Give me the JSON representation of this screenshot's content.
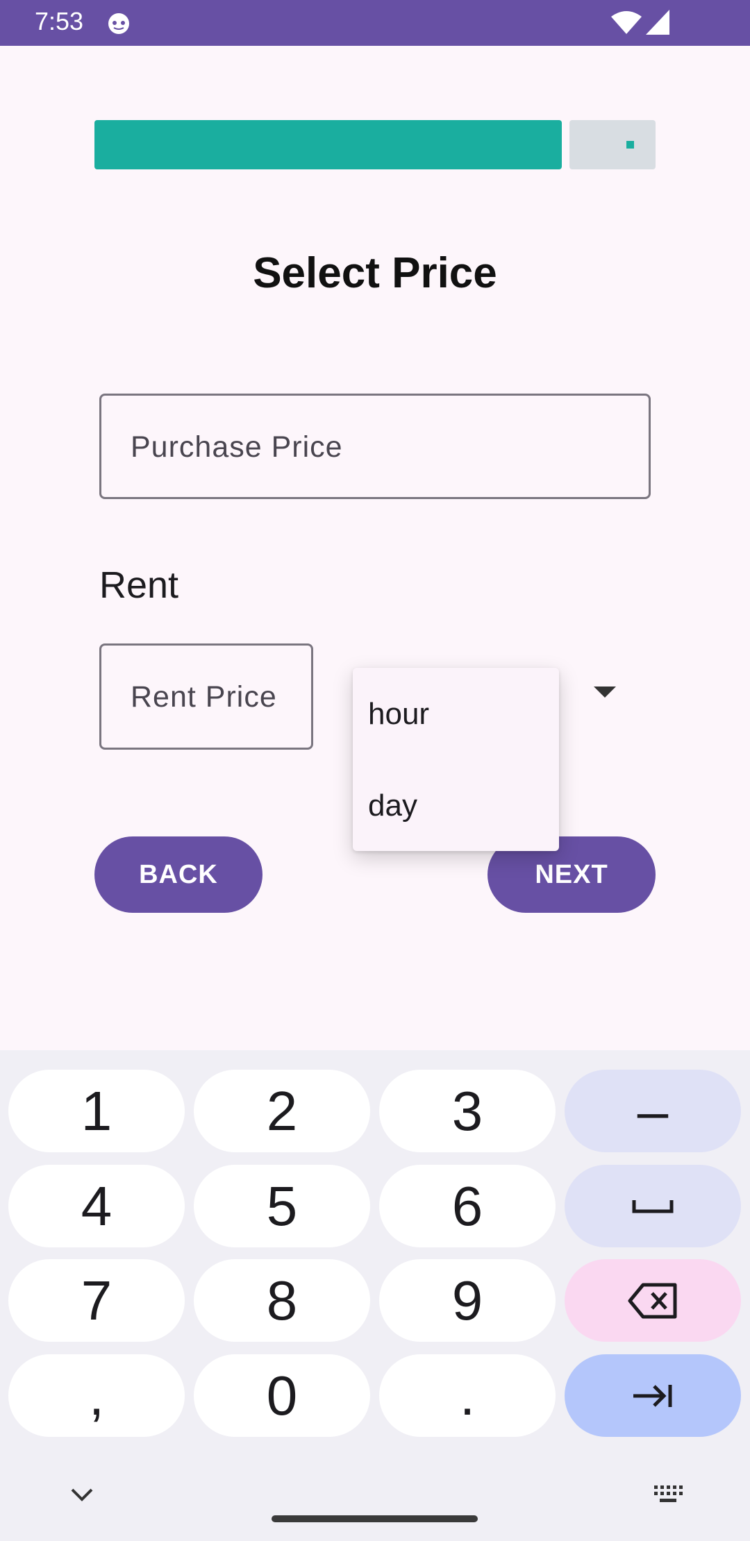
{
  "status_bar": {
    "time": "7:53",
    "background": "#6750a4"
  },
  "progress": {
    "fraction": 0.85,
    "fill_color": "#1aae9f",
    "track_color": "#d8dde2"
  },
  "page": {
    "title": "Select Price"
  },
  "purchase_price": {
    "placeholder": "Purchase Price",
    "value": ""
  },
  "rent": {
    "label": "Rent",
    "price_placeholder": "Rent Price",
    "price_value": ""
  },
  "dropdown": {
    "options": [
      "hour",
      "day"
    ],
    "icon": "caret-down-icon"
  },
  "buttons": {
    "back": "BACK",
    "next": "NEXT",
    "color": "#6750a4"
  },
  "keyboard": {
    "rows": [
      [
        "1",
        "2",
        "3",
        "–"
      ],
      [
        "4",
        "5",
        "6",
        "space-icon"
      ],
      [
        "7",
        "8",
        "9",
        "backspace-icon"
      ],
      [
        ",",
        "0",
        ".",
        "tab-next-icon"
      ]
    ],
    "digits": {
      "k1": "1",
      "k2": "2",
      "k3": "3",
      "k4": "4",
      "k5": "5",
      "k6": "6",
      "k7": "7",
      "k8": "8",
      "k9": "9",
      "comma": ",",
      "k0": "0",
      "period": ".",
      "dash": "–"
    }
  }
}
